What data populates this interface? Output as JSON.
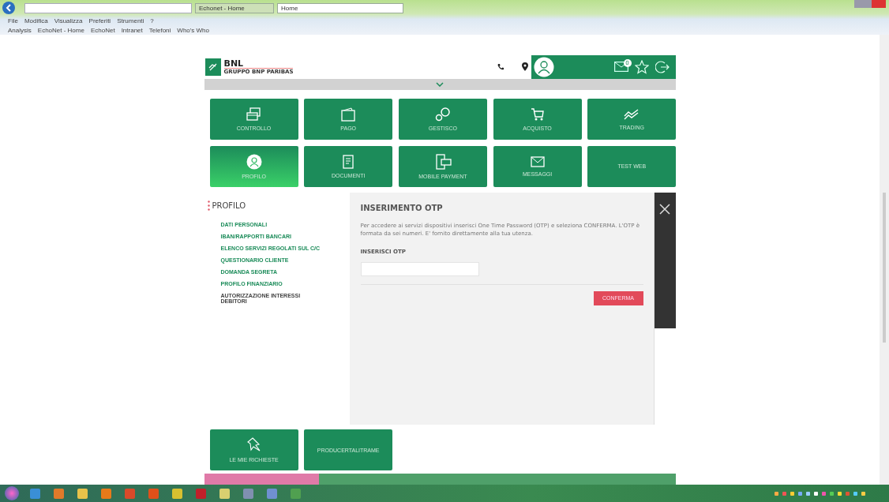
{
  "browser": {
    "tabs": [
      {
        "label": "Echonet - Home",
        "selected": false
      },
      {
        "label": "Home",
        "selected": true
      }
    ],
    "menu": [
      "File",
      "Modifica",
      "Visualizza",
      "Preferiti",
      "Strumenti",
      "?"
    ],
    "favorites": [
      "Analysis",
      "EchoNet - Home",
      "EchoNet",
      "Intranet",
      "Telefoni",
      "Who's Who"
    ]
  },
  "header": {
    "logo": "BNL",
    "logo_subtitle": "GRUPPO BNP PARIBAS",
    "messages_badge": "0"
  },
  "tiles": [
    {
      "label": "CONTROLLO",
      "kind": "card",
      "selected": false
    },
    {
      "label": "PAGO",
      "kind": "wallet",
      "selected": false
    },
    {
      "label": "GESTISCO",
      "kind": "gears",
      "selected": false
    },
    {
      "label": "ACQUISTO",
      "kind": "cart",
      "selected": false
    },
    {
      "label": "TRADING",
      "kind": "chart",
      "selected": false
    },
    {
      "label": "PROFILO",
      "kind": "user",
      "selected": true
    },
    {
      "label": "DOCUMENTI",
      "kind": "doc",
      "selected": false
    },
    {
      "label": "MOBILE PAYMENT",
      "kind": "phone",
      "selected": false
    },
    {
      "label": "MESSAGGI",
      "kind": "mail",
      "selected": false
    },
    {
      "label": "TEST WEB",
      "kind": "text",
      "selected": false
    }
  ],
  "sidebar": {
    "title": "PROFILO",
    "items": [
      {
        "label": "DATI PERSONALI",
        "selected": false
      },
      {
        "label": "IBAN/RAPPORTI BANCARI",
        "selected": false
      },
      {
        "label": "ELENCO SERVIZI REGOLATI SUL C/C",
        "selected": false
      },
      {
        "label": "QUESTIONARIO CLIENTE",
        "selected": false
      },
      {
        "label": "DOMANDA SEGRETA",
        "selected": false
      },
      {
        "label": "PROFILO FINANZIARIO",
        "selected": false
      },
      {
        "label": "AUTORIZZAZIONE INTERESSI DEBITORI",
        "selected": true
      }
    ]
  },
  "otp": {
    "title": "INSERIMENTO OTP",
    "text": "Per accedere ai servizi dispositivi inserisci One Time Password (OTP) e seleziona CONFERMA. L'OTP è formata da sei numeri. E' fornito direttamente alla tua utenza.",
    "field_label": "INSERISCI OTP",
    "button": "CONFERMA"
  },
  "bottom_tiles": [
    {
      "label": "LE MIE RICHIESTE",
      "kind": "pin"
    },
    {
      "label": "PRODUCERTALITRAME",
      "kind": "text"
    }
  ]
}
